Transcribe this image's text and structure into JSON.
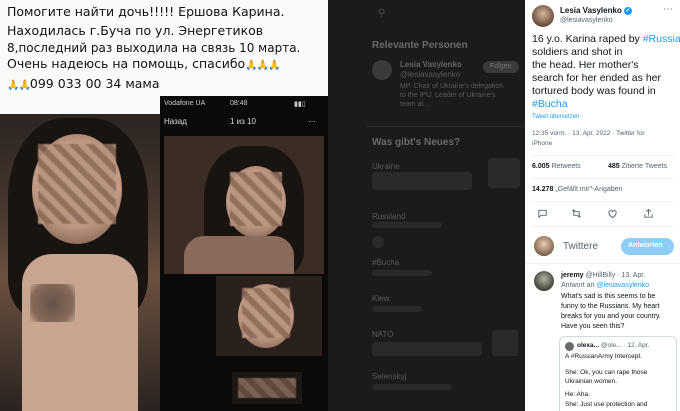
{
  "photo": {
    "caption_lines": [
      "Помогите найти дочь!!!!! Ершова Карина.",
      "Находилась г.Буча по ул. Энергетиков",
      "8,последний раз выходила на связь 10 марта.",
      "Очень надеюсь на помощь, спасибо",
      "099 033 00 34 мама"
    ],
    "emoji_pray": "🙏🙏🙏",
    "emoji_pray_short": "🙏🙏",
    "status_carrier": "Vodafone UA",
    "status_time": "08:48",
    "nav_back": "Назад",
    "nav_counter": "1 из 10"
  },
  "middle": {
    "relevant_heading": "Relevante Personen",
    "relevant_name": "Lesia Vasylenko",
    "relevant_handle": "@lesiavasylenko",
    "relevant_bio": "MP. Chair of Ukraine's delegation to the IPU. Leader of Ukraine's team at ...",
    "follow_label": "Folgen",
    "trends_heading": "Was gibt's Neues?",
    "trend_items": [
      "Ukraine",
      "Russland",
      "#Bucha",
      "Kiew",
      "NATO",
      "Selenskyj"
    ]
  },
  "tweet": {
    "author_name": "Lesia Vasylenko",
    "author_handle": "@lesiavasylenko",
    "body_part1": "16 y.o. Karina raped by",
    "body_hashtag_russia": "#Russia",
    "body_part2": "soldiers and shot in",
    "body_line3": "the head. Her mother's",
    "body_line4": "search for her ended as her",
    "body_line5": "tortured body was found in",
    "body_hashtag_bucha": "#Bucha",
    "translate_label": "Tweet übersetzen",
    "timestamp": "12:35 vorm. · 13. Apr. 2022 · Twitter for",
    "source_line2": "iPhone",
    "retweets_count": "6.005",
    "retweets_label": "Retweets",
    "quotes_count": "485",
    "quotes_label": "Zitierte Tweets",
    "likes_count": "14.278",
    "likes_label": "„Gefällt mir\"-Angaben",
    "reply_placeholder": "Twittere",
    "reply_button": "Antworten",
    "accent_color": "#1d9bf0"
  },
  "reply": {
    "name": "jeremy",
    "handle": "@HillBilly",
    "date": "· 13. Apr.",
    "reply_to_prefix": "Antwort an",
    "reply_to_handle": "@lesiavasylenko",
    "text_lines": [
      "What's sad is this seems to be",
      "funny to the Russians. My heart",
      "breaks for you and your country.",
      "Have you seen this?"
    ],
    "quote_name": "olexa...",
    "quote_handle": "@ole...",
    "quote_date": "· 12. Apr.",
    "quote_hashtag": "A #RussianArmy Intercept.",
    "quote_lines": [
      "She: Ok, you can rape those",
      "Ukrainian women.",
      "He: Aha.",
      "She: Just use protection and"
    ]
  }
}
